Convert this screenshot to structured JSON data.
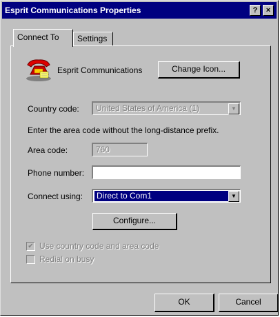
{
  "window": {
    "title": "Esprit Communications Properties",
    "help_glyph": "?",
    "close_glyph": "×"
  },
  "tabs": [
    {
      "label": "Connect To",
      "active": true
    },
    {
      "label": "Settings",
      "active": false
    }
  ],
  "connection": {
    "name": "Esprit Communications",
    "change_icon_button": "Change Icon...",
    "icon": "phone-icon"
  },
  "country_code": {
    "label": "Country code:",
    "value": "United States of America (1)"
  },
  "instruction": "Enter the area code without the long-distance prefix.",
  "area_code": {
    "label": "Area code:",
    "value": "760"
  },
  "phone_number": {
    "label": "Phone number:",
    "value": ""
  },
  "connect_using": {
    "label": "Connect using:",
    "value": "Direct to Com1"
  },
  "configure_button": "Configure...",
  "checkboxes": [
    {
      "label": "Use country code and area code",
      "checked": true,
      "enabled": false
    },
    {
      "label": "Redial on busy",
      "checked": false,
      "enabled": false
    }
  ],
  "footer": {
    "ok": "OK",
    "cancel": "Cancel"
  },
  "colors": {
    "titlebar": "#000080",
    "face": "#c0c0c0",
    "selection": "#000080"
  }
}
